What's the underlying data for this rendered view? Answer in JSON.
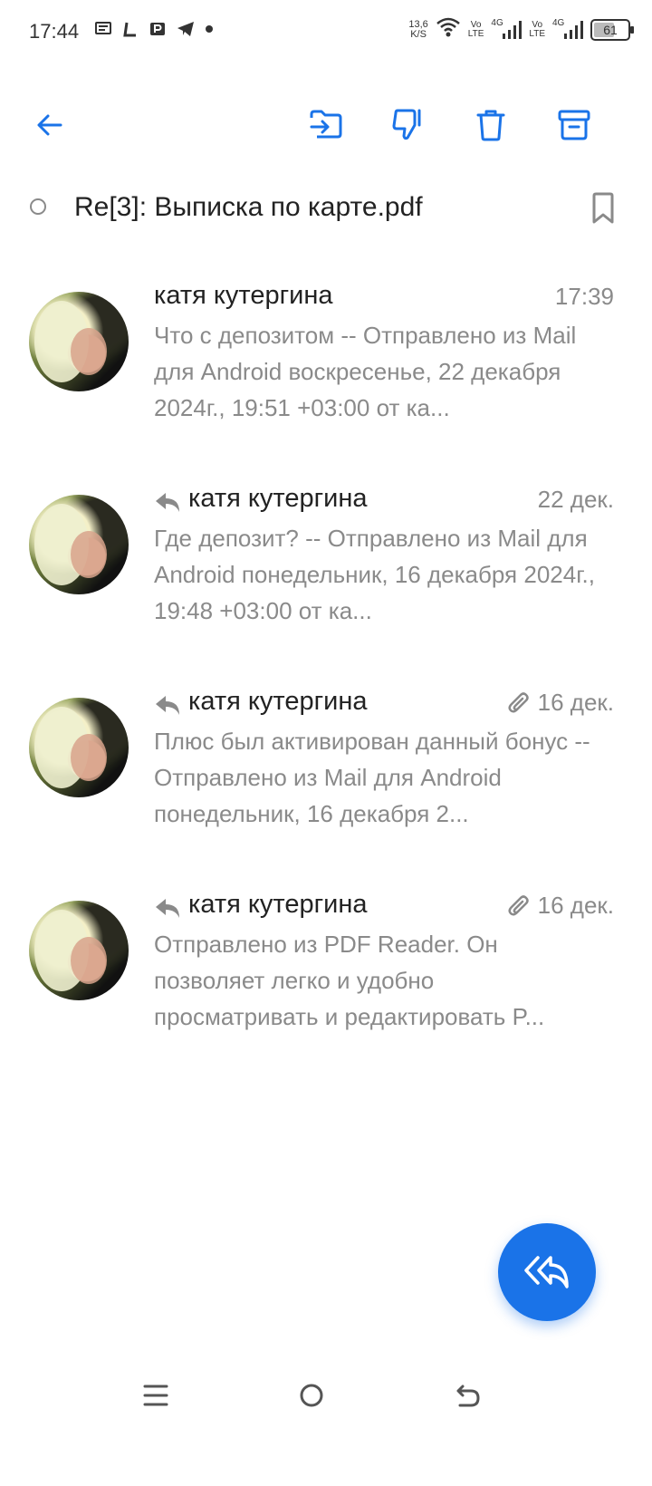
{
  "status_bar": {
    "time": "17:44",
    "net_speed_value": "13,6",
    "net_speed_unit": "K/S",
    "sim1_tag_top": "Vo",
    "sim1_tag_bottom": "LTE",
    "sim1_network": "4G",
    "sim2_tag_top": "Vo",
    "sim2_tag_bottom": "LTE",
    "sim2_network": "4G",
    "battery_level": "61",
    "battery_fraction": 0.61,
    "left_icons": [
      "message-icon",
      "l-app-icon",
      "parking-icon",
      "telegram-icon",
      "dot-icon"
    ]
  },
  "toolbar": {
    "icons": [
      "back-arrow-icon",
      "move-to-folder-icon",
      "spam-icon",
      "trash-icon",
      "archive-icon"
    ],
    "accent_color": "#1a73e8"
  },
  "subject": {
    "text": "Re[3]: Выписка по карте.pdf"
  },
  "messages": [
    {
      "sender": "катя кутергина",
      "time": "17:39",
      "replied": false,
      "has_attachment": false,
      "preview": "Что с депозитом -- Отправлено из Mail для Android воскресенье, 22 декабря 2024г., 19:51 +03:00 от ка..."
    },
    {
      "sender": "катя кутергина",
      "time": "22 дек.",
      "replied": true,
      "has_attachment": false,
      "preview": "Где депозит? -- Отправлено из Mail для Android понедельник, 16 декабря 2024г., 19:48 +03:00 от ка..."
    },
    {
      "sender": "катя кутергина",
      "time": "16 дек.",
      "replied": true,
      "has_attachment": true,
      "preview": "Плюс был активирован данный бонус -- Отправлено из Mail для Android понедельник, 16 декабря 2..."
    },
    {
      "sender": "катя кутергина",
      "time": "16 дек.",
      "replied": true,
      "has_attachment": true,
      "preview": "Отправлено из PDF Reader. Он позволяет легко и удобно просматривать и редактировать P..."
    }
  ],
  "fab": {
    "icon": "reply-all-icon",
    "color": "#1a73e8"
  },
  "nav_bar": {
    "icons": [
      "menu-icon",
      "home-icon",
      "back-icon"
    ]
  }
}
